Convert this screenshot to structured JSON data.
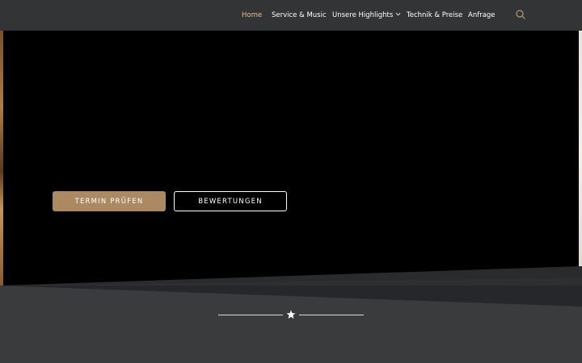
{
  "nav": {
    "items": [
      {
        "label": "Home",
        "active": true
      },
      {
        "label": "Service & Music"
      },
      {
        "label": "Unsere Highlights",
        "has_dropdown": true
      },
      {
        "label": "Technik & Preise"
      },
      {
        "label": "Anfrage"
      }
    ],
    "search_icon": "search-icon",
    "dropdown_icon": "chevron-down-icon"
  },
  "hero": {
    "primary_button": "TERMIN PRÜFEN",
    "secondary_button": "BEWERTUNGEN"
  },
  "divider": {
    "icon": "star-icon"
  },
  "colors": {
    "header_bg": "#333436",
    "active_nav": "#e0c08f",
    "accent": "#ab8a61",
    "hero_bg": "#000000",
    "section_bg": "#3a3b3d"
  }
}
